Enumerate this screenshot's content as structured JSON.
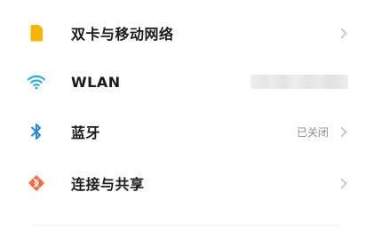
{
  "settings": {
    "items": [
      {
        "label": "双卡与移动网络",
        "icon": "sim-card-icon",
        "icon_color": "#F7B500",
        "value": ""
      },
      {
        "label": "WLAN",
        "icon": "wifi-icon",
        "icon_color": "#1AA8E6",
        "value": ""
      },
      {
        "label": "蓝牙",
        "icon": "bluetooth-icon",
        "icon_color": "#1E88E5",
        "value": "已关闭"
      },
      {
        "label": "连接与共享",
        "icon": "connection-sharing-icon",
        "icon_color": "#F26A3D",
        "value": ""
      }
    ]
  },
  "colors": {
    "label_text": "#1a1a1a",
    "value_text": "#8c8c8c",
    "chevron": "#b5b5b5"
  }
}
